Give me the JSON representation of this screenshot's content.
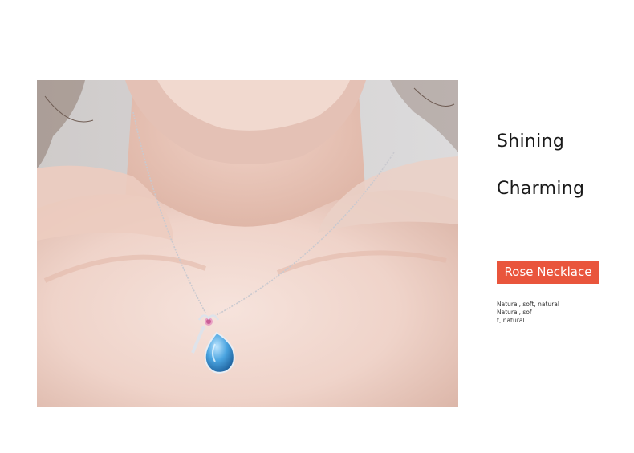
{
  "headline": {
    "line1": "Shining",
    "line2": "Charming"
  },
  "badge": {
    "label": "Rose Necklace",
    "color": "#e9553c"
  },
  "description": {
    "lines": [
      "Natural, soft, natural",
      "Natural, sof",
      "t, natural"
    ]
  },
  "photo": {
    "icon": "necklace-photo"
  }
}
